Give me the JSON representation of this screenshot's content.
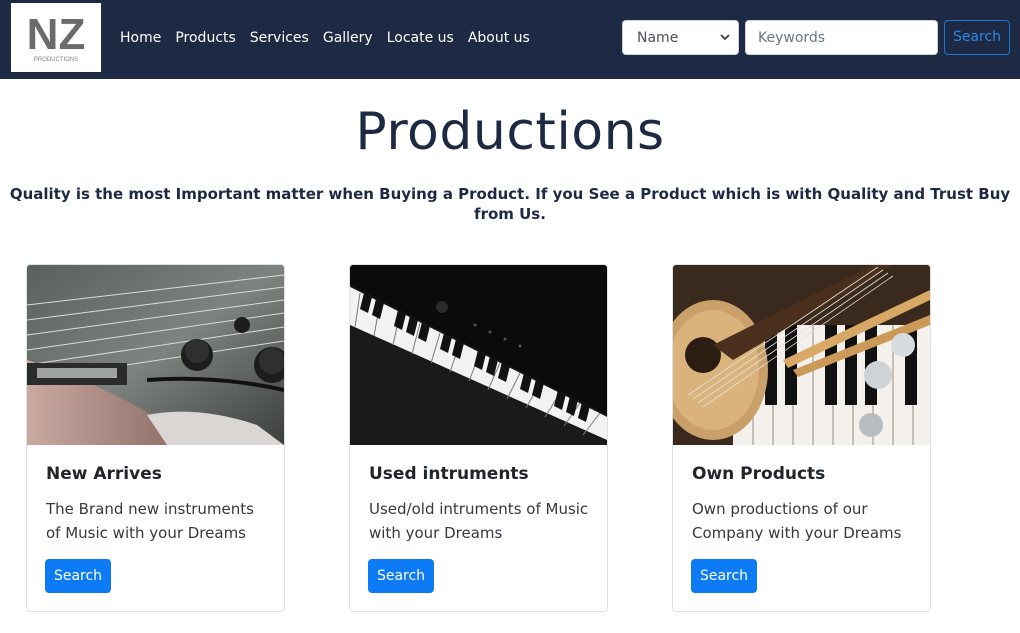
{
  "logo": {
    "letters": "NZ",
    "subtitle": "PRODUCTIONS"
  },
  "nav": {
    "links": [
      "Home",
      "Products",
      "Services",
      "Gallery",
      "Locate us",
      "About us"
    ],
    "select_value": "Name",
    "keyword_placeholder": "Keywords",
    "search_label": "Search"
  },
  "header": {
    "title": "Productions",
    "tagline": "Quality is the most Important matter when Buying a Product. If you See a Product which is with Quality and Trust Buy from Us."
  },
  "cards": [
    {
      "title": "New Arrives",
      "text": "The Brand new instruments of Music with your Dreams",
      "button": "Search",
      "image": "electric-guitar-photo"
    },
    {
      "title": "Used intruments",
      "text": "Used/old intruments of Music with your Dreams",
      "button": "Search",
      "image": "digital-piano-photo"
    },
    {
      "title": "Own Products",
      "text": "Own productions of our Company with your Dreams",
      "button": "Search",
      "image": "ukulele-piano-photo"
    }
  ],
  "colors": {
    "navbar": "#1e2a44",
    "primary": "#0d7bf5",
    "title": "#1e2a44"
  }
}
